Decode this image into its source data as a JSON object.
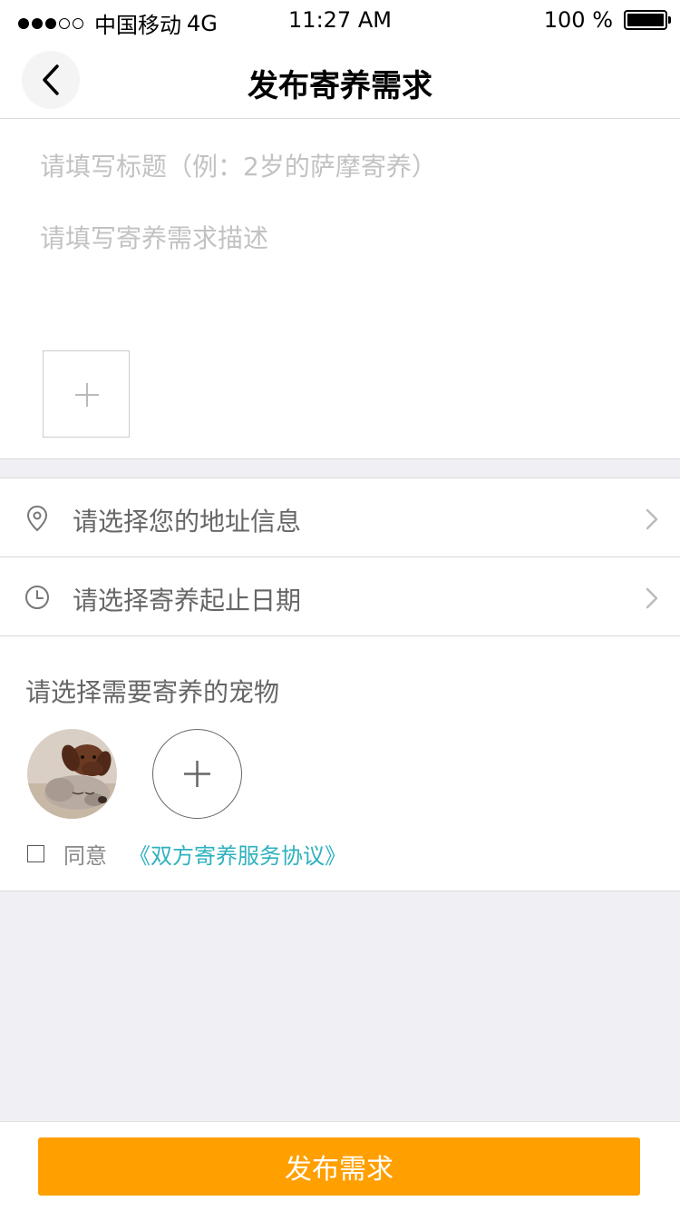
{
  "status_bar": {
    "carrier": "中国移动",
    "network": "4G",
    "time": "11:27 AM",
    "battery": "100 %",
    "signal_strength_of_5": 3
  },
  "nav": {
    "title": "发布寄养需求",
    "back_icon": "chevron-left-icon"
  },
  "form": {
    "title_placeholder": "请填写标题（例：2岁的萨摩寄养）",
    "description_placeholder": "请填写寄养需求描述",
    "add_photo_icon": "plus-icon"
  },
  "rows": {
    "address": {
      "label": "请选择您的地址信息",
      "icon": "location-pin-icon"
    },
    "dates": {
      "label": "请选择寄养起止日期",
      "icon": "clock-icon"
    }
  },
  "pets": {
    "heading": "请选择需要寄养的宠物",
    "add_icon": "plus-icon"
  },
  "agreement": {
    "agree_label": "同意",
    "link_text": "《双方寄养服务协议》",
    "checked": false
  },
  "actions": {
    "publish_label": "发布需求"
  },
  "colors": {
    "accent": "#ff9f00",
    "link": "#2eb1bf",
    "background": "#efeff4",
    "placeholder": "#c2c2c2"
  }
}
